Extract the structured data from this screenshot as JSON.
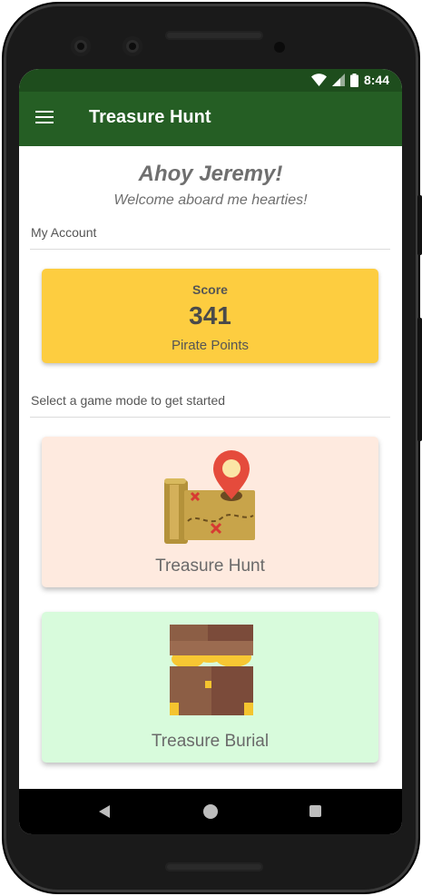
{
  "status_bar": {
    "time": "8:44"
  },
  "app_bar": {
    "title": "Treasure Hunt",
    "menu_icon": "menu-icon"
  },
  "greeting": {
    "title": "Ahoy Jeremy!",
    "subtitle": "Welcome aboard me hearties!"
  },
  "account": {
    "section_label": "My Account",
    "score": {
      "label": "Score",
      "value": "341",
      "unit": "Pirate Points"
    }
  },
  "game_modes": {
    "section_label": "Select a game mode to get started",
    "modes": [
      {
        "label": "Treasure Hunt",
        "icon": "treasure-map-icon"
      },
      {
        "label": "Treasure Burial",
        "icon": "treasure-chest-icon"
      }
    ]
  },
  "colors": {
    "status_bar": "#1e4d1d",
    "app_bar": "#255e24",
    "score_card": "#fdcd40",
    "hunt_card": "#feeadf",
    "burial_card": "#d8fbdc"
  }
}
